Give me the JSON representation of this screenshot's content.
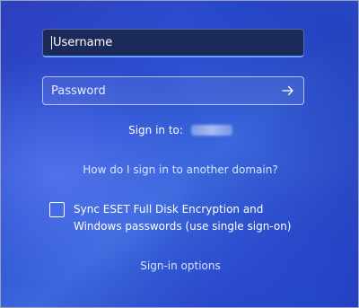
{
  "login": {
    "username_placeholder": "Username",
    "username_value": "",
    "password_placeholder": "Password",
    "password_value": "",
    "submit_icon": "arrow-right-icon"
  },
  "signin": {
    "label": "Sign in to:",
    "domain_redacted": true
  },
  "links": {
    "other_domain": "How do I sign in to another domain?",
    "sign_in_options": "Sign-in options"
  },
  "sync": {
    "checked": false,
    "label_line1": "Sync ESET Full Disk Encryption and",
    "label_line2": "Windows passwords (use single sign-on)"
  },
  "colors": {
    "background_primary": "#2b4fd0",
    "username_field_bg": "#1c2a5a",
    "focus_underline": "#6b9cff",
    "link_text": "#d9e3ff"
  }
}
